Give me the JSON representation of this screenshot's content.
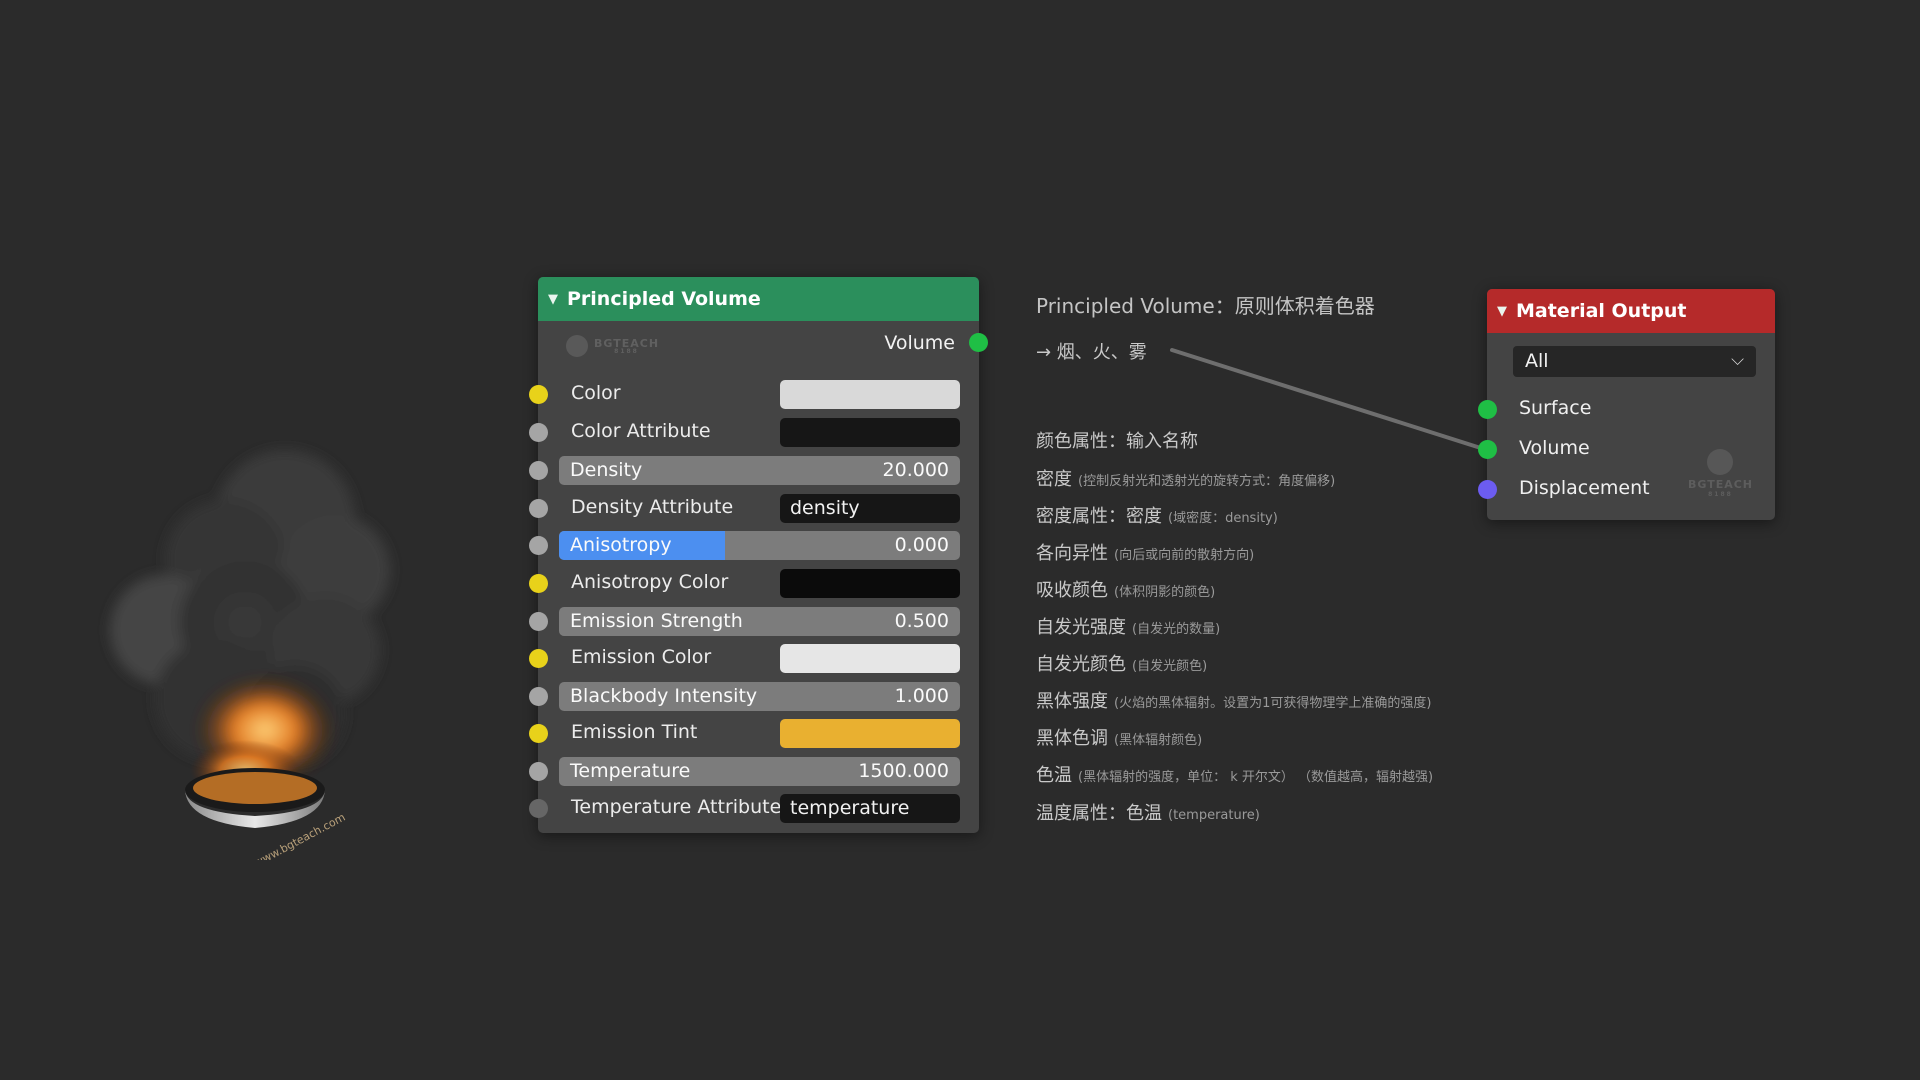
{
  "colors": {
    "background": "#2b2b2b",
    "node_body": "#444444",
    "pv_header": "#2b8f5c",
    "mo_header": "#b52a2a",
    "socket_color": "#e8d21a",
    "socket_float": "#a5a5a5",
    "socket_shader": "#1fbf45",
    "socket_vector": "#6c5cf0",
    "slider_active": "#4c8ff0",
    "emission_tint": "#e9b030"
  },
  "illustration": {
    "watermark": "www.bgteach.com"
  },
  "principled_volume": {
    "title": "Principled Volume",
    "watermark": {
      "name": "BGTEACH",
      "sub": "8188"
    },
    "output_label": "Volume",
    "rows": [
      {
        "label": "Color",
        "socket": "color",
        "widget": "swatch",
        "swatch_color": "#d9d9d9"
      },
      {
        "label": "Color Attribute",
        "socket": "float",
        "widget": "text",
        "value": ""
      },
      {
        "label": "Density",
        "socket": "float",
        "widget": "slider",
        "value": "20.000"
      },
      {
        "label": "Density Attribute",
        "socket": "float",
        "widget": "text",
        "value": "density"
      },
      {
        "label": "Anisotropy",
        "socket": "float",
        "widget": "slider",
        "value": "0.000",
        "fill_fraction": 0.415,
        "active": true
      },
      {
        "label": "Anisotropy Color",
        "socket": "color",
        "widget": "swatch",
        "swatch_color": "#0b0b0b"
      },
      {
        "label": "Emission Strength",
        "socket": "float",
        "widget": "slider",
        "value": "0.500"
      },
      {
        "label": "Emission Color",
        "socket": "color",
        "widget": "swatch",
        "swatch_color": "#e6e6e6"
      },
      {
        "label": "Blackbody Intensity",
        "socket": "float",
        "widget": "slider",
        "value": "1.000"
      },
      {
        "label": "Emission Tint",
        "socket": "color",
        "widget": "swatch",
        "swatch_color": "#e9b030"
      },
      {
        "label": "Temperature",
        "socket": "float",
        "widget": "slider",
        "value": "1500.000"
      },
      {
        "label": "Temperature Attribute",
        "socket": "float_dim",
        "widget": "text",
        "value": "temperature"
      }
    ]
  },
  "material_output": {
    "title": "Material Output",
    "target": "All",
    "watermark": {
      "name": "BGTEACH",
      "sub": "8188"
    },
    "inputs": [
      {
        "label": "Surface",
        "socket": "shader"
      },
      {
        "label": "Volume",
        "socket": "shader"
      },
      {
        "label": "Displacement",
        "socket": "vector"
      }
    ]
  },
  "annotations": {
    "title": "Principled Volume：原则体积着色器",
    "subtitle": "→ 烟、火、雾",
    "items": [
      {
        "main": "颜色属性：输入名称",
        "note": ""
      },
      {
        "main": "密度",
        "note": "(控制反射光和透射光的旋转方式：角度偏移)"
      },
      {
        "main": "密度属性：密度",
        "note": "(域密度：density)"
      },
      {
        "main": "各向异性",
        "note": "(向后或向前的散射方向)"
      },
      {
        "main": "吸收颜色",
        "note": "(体积阴影的颜色)"
      },
      {
        "main": "自发光强度",
        "note": "(自发光的数量)"
      },
      {
        "main": "自发光颜色",
        "note": "(自发光颜色)"
      },
      {
        "main": "黑体强度",
        "note": "(火焰的黑体辐射。设置为1可获得物理学上准确的强度)"
      },
      {
        "main": "黑体色调",
        "note": "(黑体辐射颜色)"
      },
      {
        "main": "色温",
        "note": "(黑体辐射的强度，单位： k 开尔文） （数值越高，辐射越强)"
      },
      {
        "main": "温度属性：色温",
        "note": "(temperature)"
      }
    ]
  }
}
